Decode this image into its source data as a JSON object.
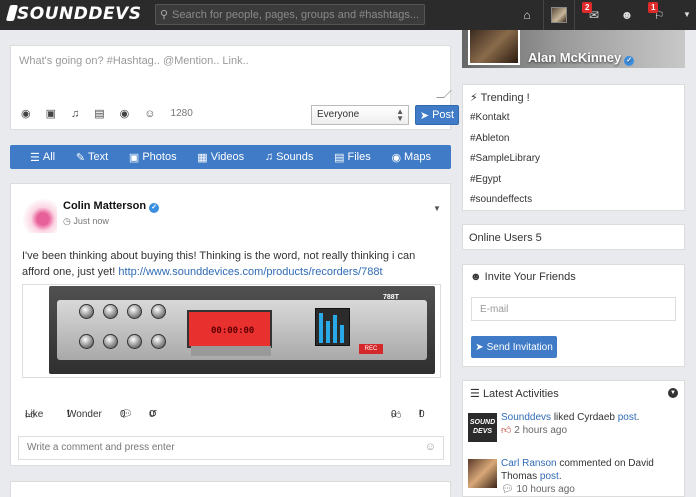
{
  "topbar": {
    "logo": "SOUNDDEVS",
    "search_placeholder": "Search for people, pages, groups and #hashtags...",
    "messages_badge": "2",
    "notifications_badge": "1"
  },
  "composer": {
    "placeholder": "What's going on? #Hashtag.. @Mention.. Link..",
    "char_count": "1280",
    "privacy": "Everyone",
    "post_label": "Post"
  },
  "filters": [
    {
      "icon": "list-icon",
      "label": "All"
    },
    {
      "icon": "pencil-icon",
      "label": "Text"
    },
    {
      "icon": "image-icon",
      "label": "Photos"
    },
    {
      "icon": "film-icon",
      "label": "Videos"
    },
    {
      "icon": "music-icon",
      "label": "Sounds"
    },
    {
      "icon": "file-icon",
      "label": "Files"
    },
    {
      "icon": "map-marker-icon",
      "label": "Maps"
    }
  ],
  "post": {
    "author": "Colin Matterson",
    "time": "Just now",
    "text": "I've been thinking about buying this! Thinking is the word, not really thinking i can afford one, just yet! ",
    "link": "http://www.sounddevices.com/products/recorders/788t",
    "device_display": "00:00:00",
    "device_model": "788T",
    "device_rec": "REC",
    "like_label": "Like",
    "wonder_label": "Wonder",
    "comments_count": "0",
    "shares_count": "0",
    "likes_count": "0",
    "wonders_count": "0",
    "comment_placeholder": "Write a comment and press enter"
  },
  "profile": {
    "name": "Alan McKinney"
  },
  "trending": {
    "title": "Trending !",
    "tags": [
      "#Kontakt",
      "#Ableton",
      "#SampleLibrary",
      "#Egypt",
      "#soundeffects"
    ]
  },
  "online": {
    "label": "Online Users 5"
  },
  "invite": {
    "title": "Invite Your Friends",
    "email_placeholder": "E-mail",
    "button": "Send Invitation"
  },
  "activities": {
    "title": "Latest Activities",
    "items": [
      {
        "actor": "Sounddevs",
        "verb": " liked Cyrdaeb ",
        "object": "post",
        "suffix": ".",
        "time": "2 hours ago",
        "avatar_text": "SOUND DEVS"
      },
      {
        "actor": "Carl Ranson",
        "verb": " commented on David Thomas ",
        "object": "post",
        "suffix": ".",
        "time": "10 hours ago",
        "avatar_text": ""
      }
    ]
  },
  "colors": {
    "topbar": "#2b2b2b",
    "accent": "#3f7bc6",
    "background": "#e9eaed",
    "badge": "#e02b2b"
  }
}
